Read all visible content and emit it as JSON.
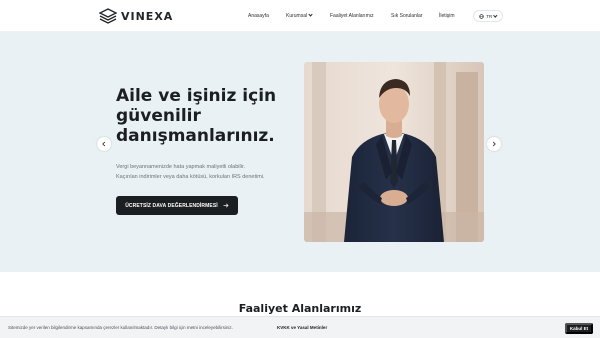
{
  "brand": {
    "name": "VINEXA"
  },
  "nav": {
    "items": [
      {
        "label": "Anasayfa",
        "has_dropdown": false
      },
      {
        "label": "Kurumsal",
        "has_dropdown": true
      },
      {
        "label": "Faaliyet Alanlarımız",
        "has_dropdown": false
      },
      {
        "label": "Sık Sorulanlar",
        "has_dropdown": false
      },
      {
        "label": "İletişim",
        "has_dropdown": false
      }
    ],
    "language": {
      "label": "TR",
      "icon": "globe-icon"
    }
  },
  "hero": {
    "title_lines": [
      "Aile ve işiniz için",
      "güvenilir",
      "danışmanlarınız."
    ],
    "subtitle_lines": [
      "Vergi beyannamenizde hata yapmak maliyetli olabilir.",
      "Kaçırılan indirimler veya daha kötüsü, korkulan IRS denetimi."
    ],
    "cta_label": "ÜCRETSİZ DAVA DEĞERLENDİRMESİ",
    "prev_icon": "chevron-left-icon",
    "next_icon": "chevron-right-icon",
    "photo": "man-in-navy-suit-photo"
  },
  "services": {
    "title": "Faaliyet Alanlarımız"
  },
  "cookie_banner": {
    "text": "Sitemizde yer verilen bilgilendirme kapsamında çerezler kullanılmaktadır. Detaylı bilgi için metni inceleyebilirsiniz.",
    "link_label": "KVKK ve Yasal Metinler",
    "accept_label": "Kabul Et"
  },
  "colors": {
    "hero_bg": "#e9f1f5",
    "dark": "#1c1f22",
    "banner_bg": "#f1f3f5"
  }
}
